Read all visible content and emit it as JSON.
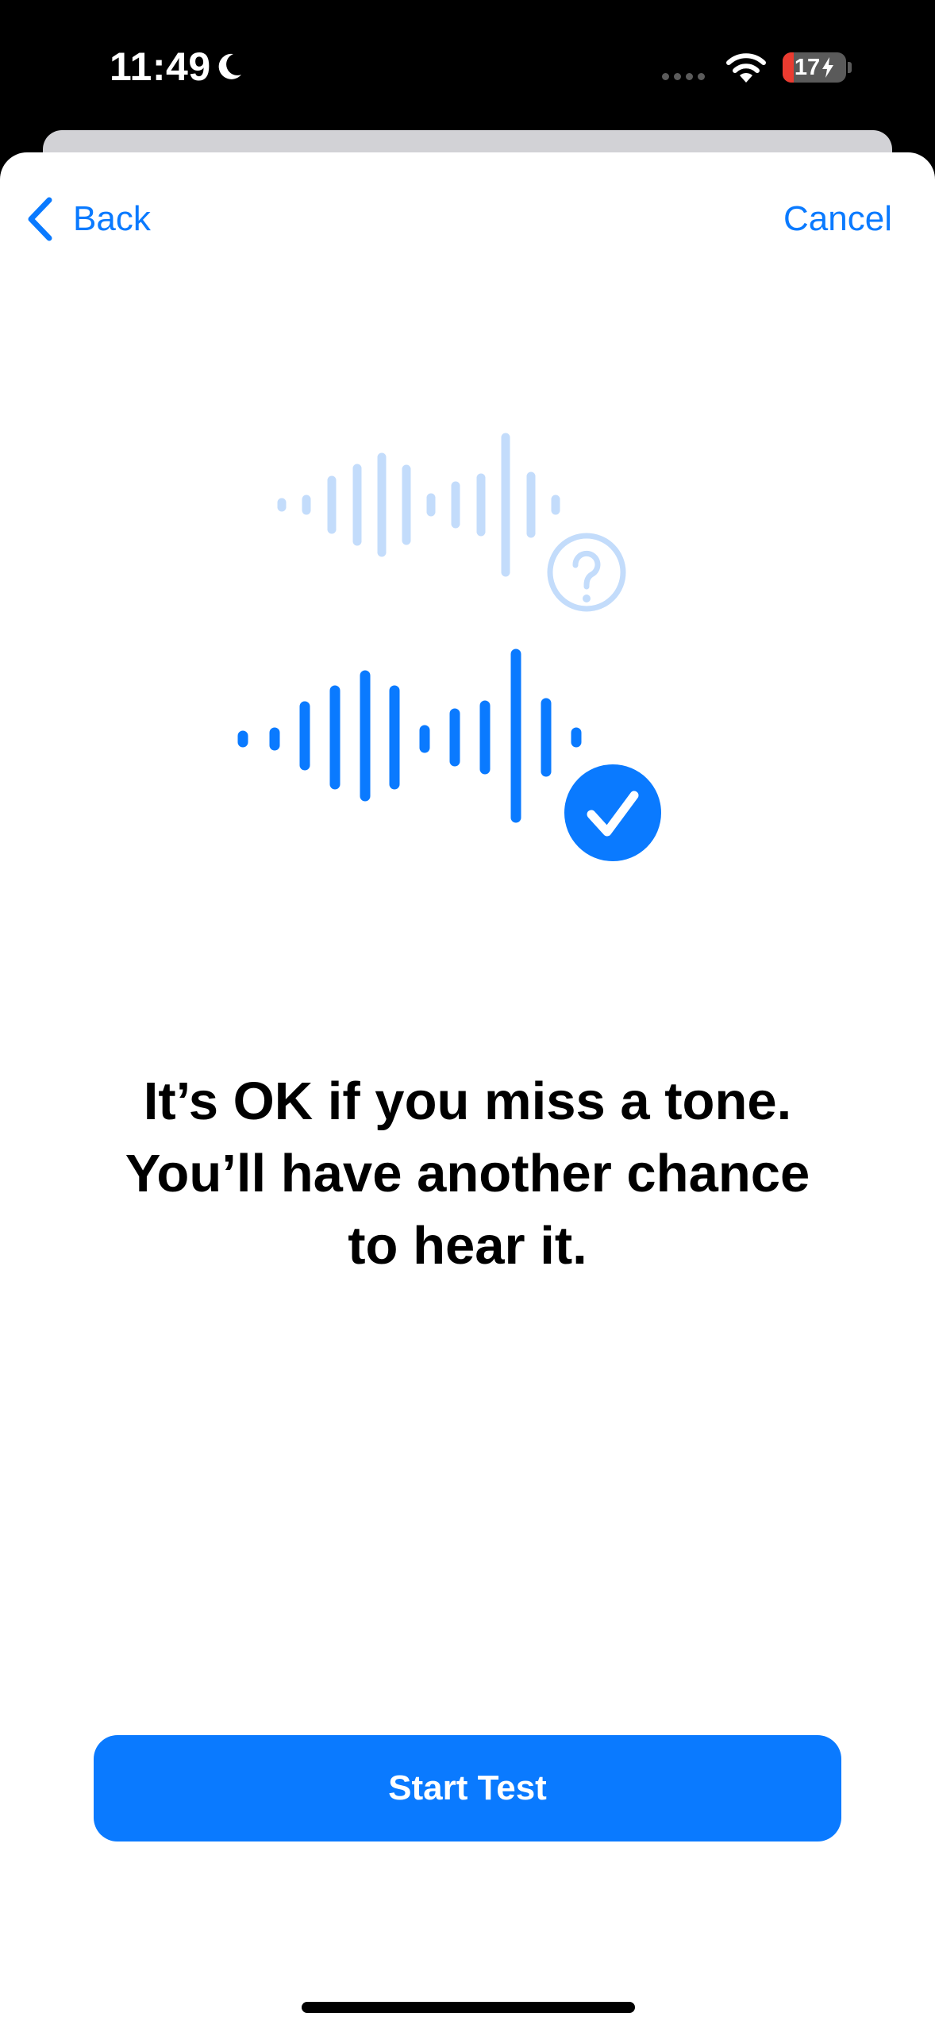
{
  "status_bar": {
    "time": "11:49",
    "battery_percent": "17",
    "battery_level": 0.17,
    "focus_icon": "moon-icon",
    "wifi_icon": "wifi-icon",
    "charging_icon": "bolt-icon"
  },
  "nav": {
    "back_label": "Back",
    "back_icon": "chevron-left-icon",
    "cancel_label": "Cancel"
  },
  "illustration": {
    "top_icon": "question-circle-icon",
    "bottom_icon": "checkmark-circle-icon",
    "waveform_icon": "waveform-icon"
  },
  "message": {
    "line1": "It’s OK if you miss a tone.",
    "line2": "You’ll have another chance",
    "line3": "to hear it."
  },
  "primary_action": {
    "label": "Start Test"
  },
  "colors": {
    "accent": "#0a7aff",
    "accent_light": "#c3dcfb",
    "battery_low": "#eb3b30",
    "text": "#000000",
    "background": "#ffffff"
  }
}
